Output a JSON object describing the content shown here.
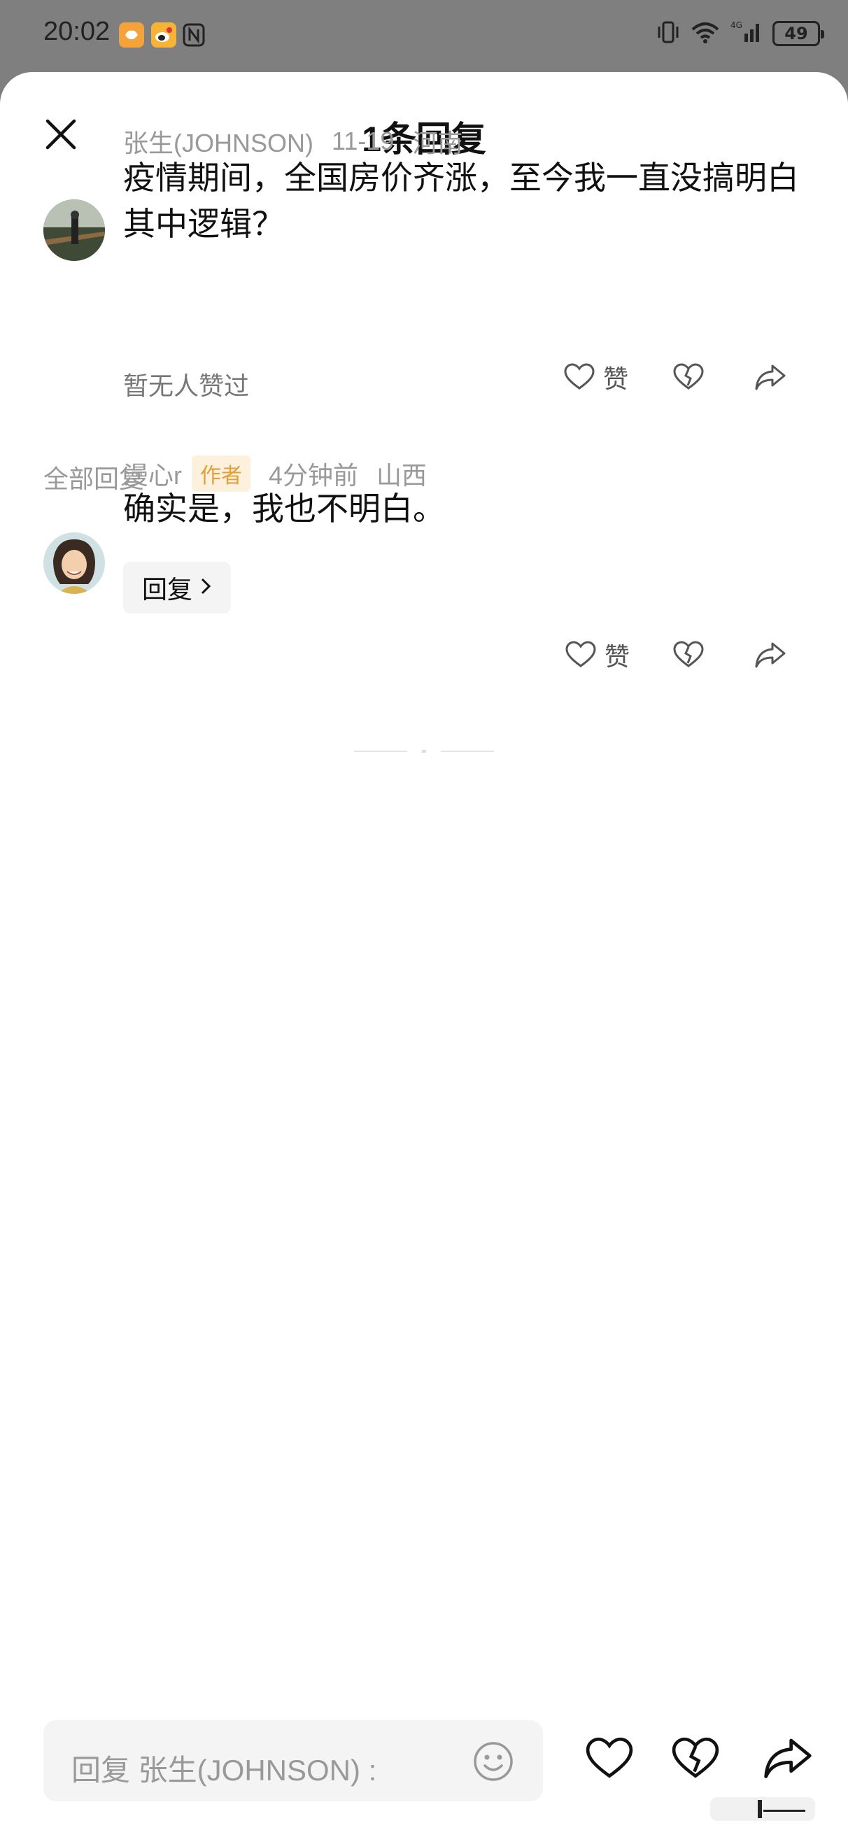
{
  "status_bar": {
    "time": "20:02",
    "battery": "49",
    "icons": [
      "taobao-icon",
      "weibo-icon",
      "nfc-icon",
      "vibrate-icon",
      "wifi-icon",
      "signal-4g-icon"
    ]
  },
  "sheet": {
    "title": "1条回复"
  },
  "original_comment": {
    "author": "张生(JOHNSON)",
    "date": "11-19",
    "location": "河南",
    "text": "疫情期间，全国房价齐涨，至今我一直没搞明白其中逻辑？",
    "likes_text": "暂无人赞过",
    "like_label": "赞"
  },
  "section_label": "全部回复",
  "replies": [
    {
      "author": "漫心r",
      "badge": "作者",
      "time": "4分钟前",
      "location": "山西",
      "text": "确实是，我也不明白。",
      "reply_button": "回复",
      "like_label": "赞"
    }
  ],
  "composer": {
    "placeholder": "回复 张生(JOHNSON) :"
  },
  "colors": {
    "badge_bg": "#fdf1dd",
    "badge_text": "#e0a036",
    "meta_gray": "#999999"
  }
}
